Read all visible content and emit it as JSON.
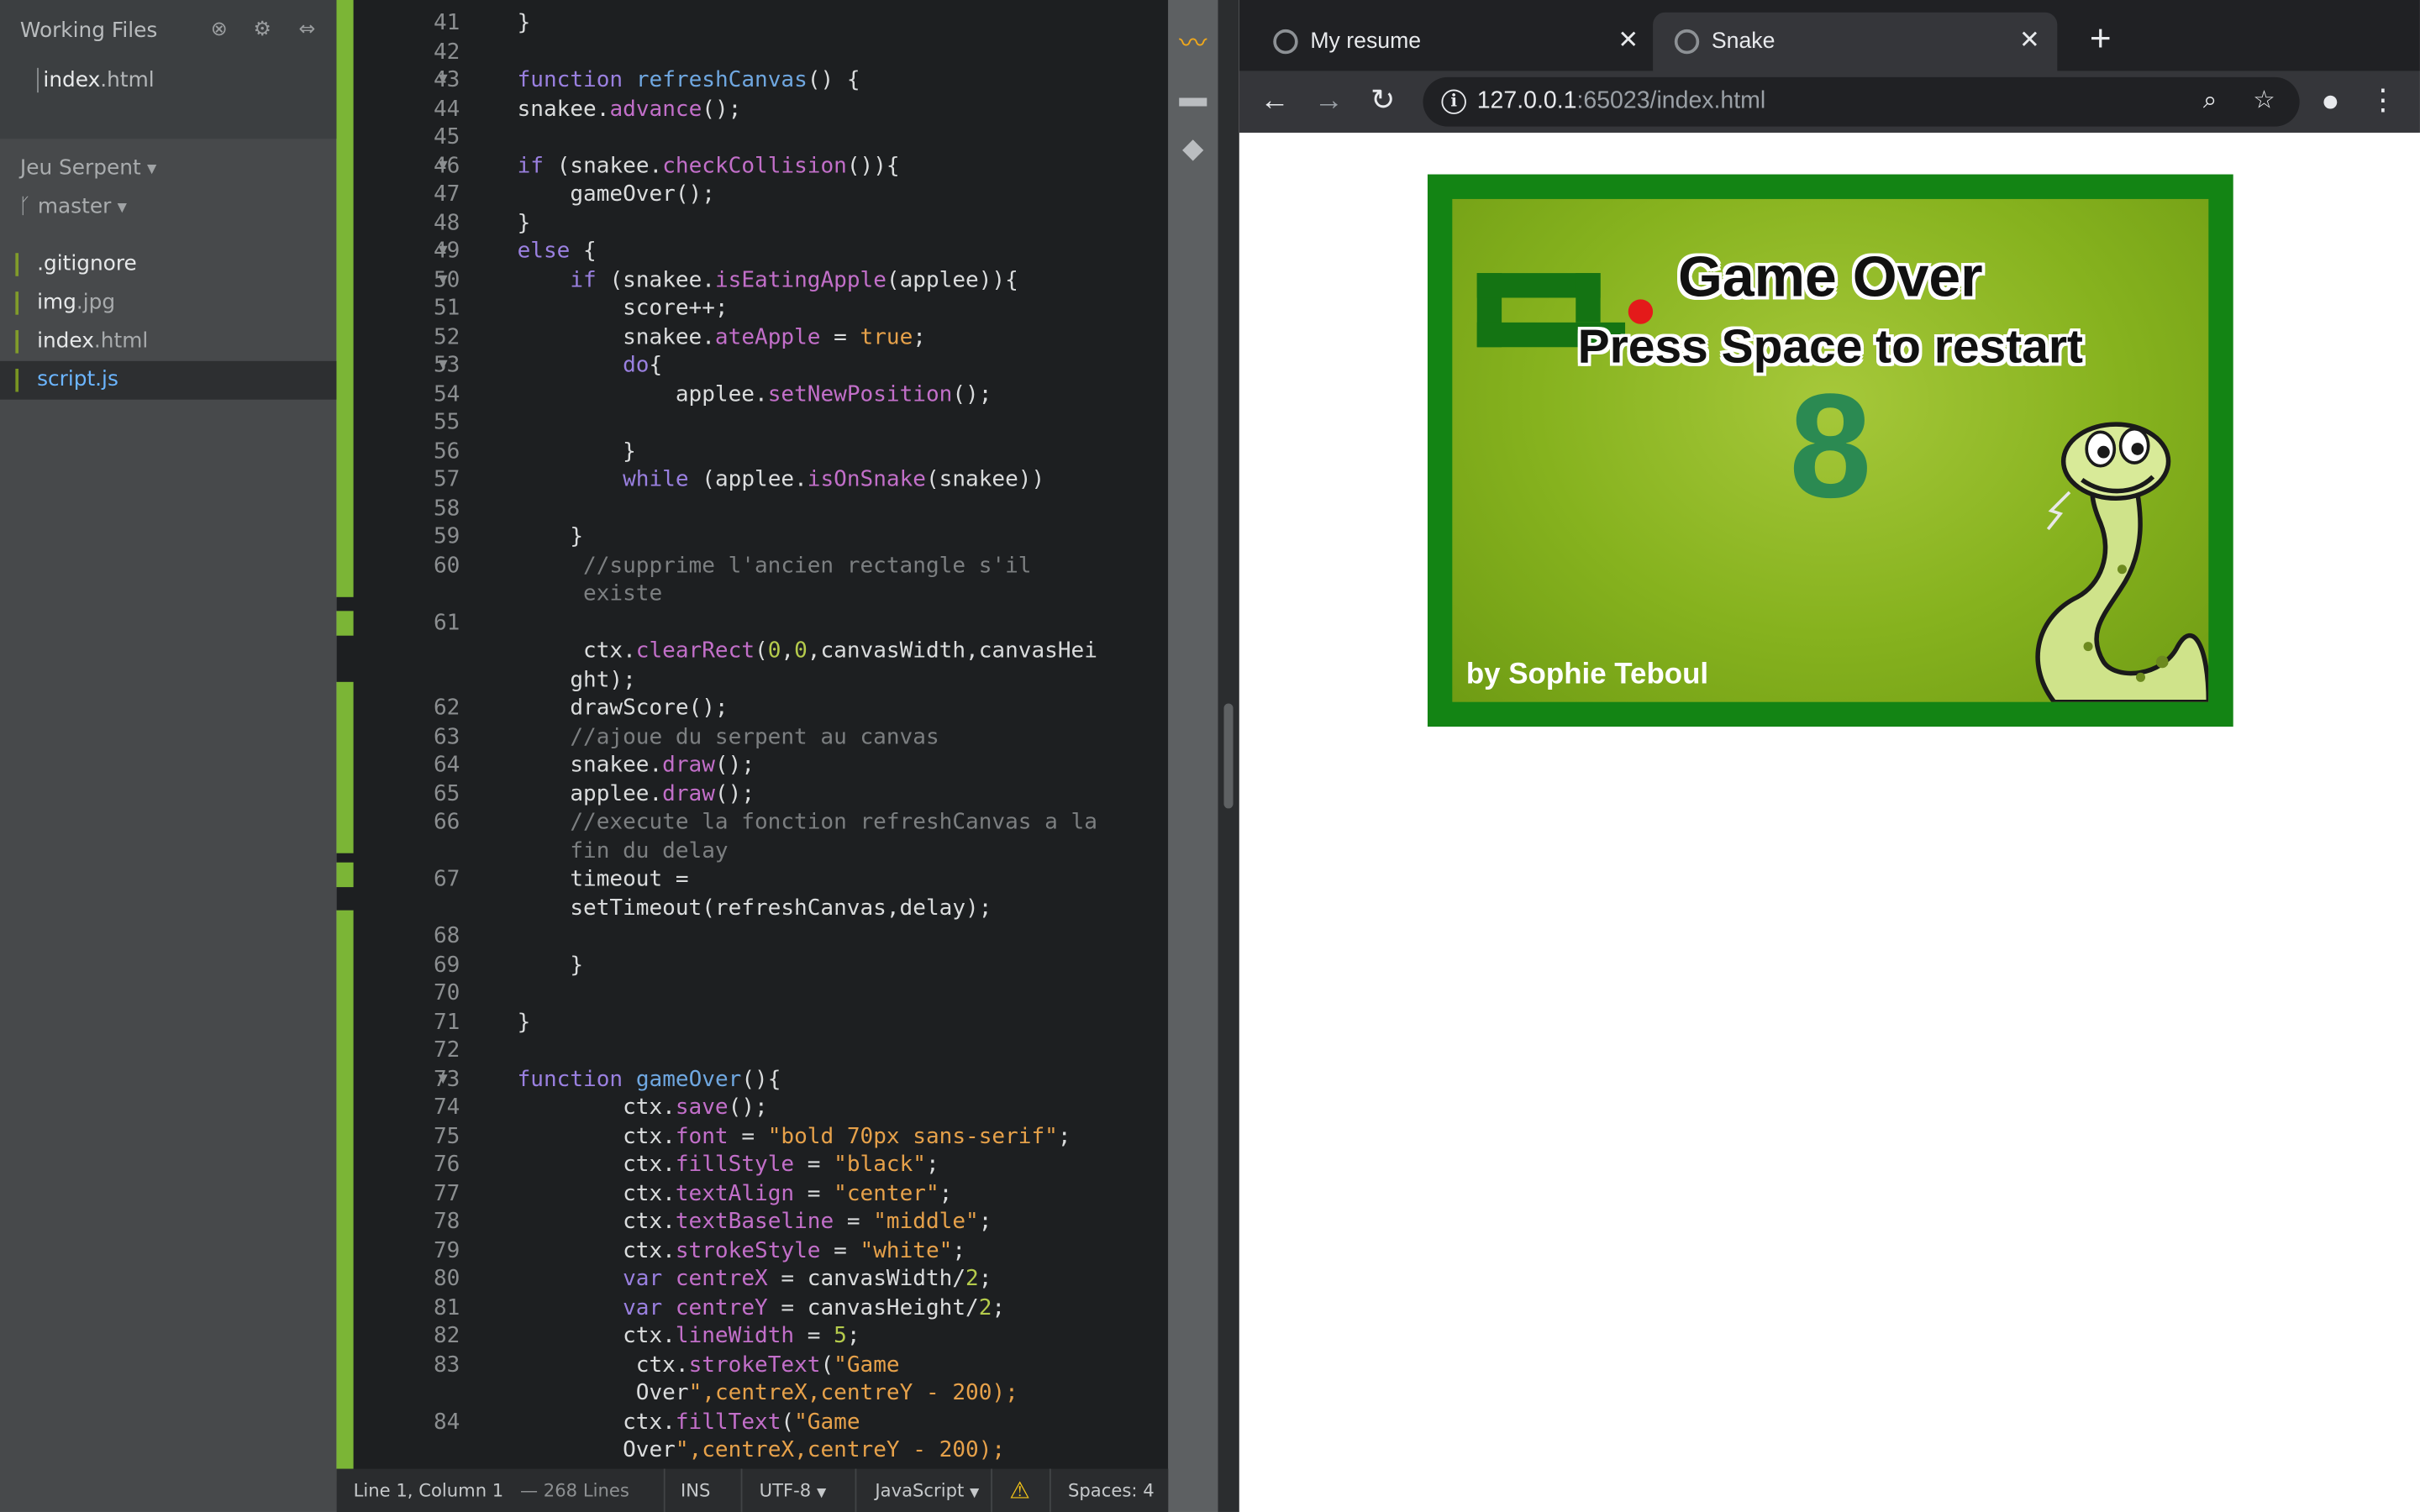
{
  "sidebar": {
    "working_files_title": "Working Files",
    "working_files": [
      {
        "name": "index",
        "ext": ".html"
      }
    ],
    "project_name": "Jeu Serpent",
    "branch": "master",
    "tree": [
      {
        "name": ".gitignore",
        "ext": ""
      },
      {
        "name": "img",
        "ext": ".jpg"
      },
      {
        "name": "index",
        "ext": ".html"
      },
      {
        "name": "script.js",
        "ext": ""
      }
    ],
    "selected_file": "script.js"
  },
  "editor": {
    "lines": [
      {
        "n": "41",
        "text": "    }"
      },
      {
        "n": "42",
        "text": ""
      },
      {
        "n": "43",
        "text": "    function refreshCanvas() {",
        "fold": true
      },
      {
        "n": "44",
        "text": "    snakee.advance();"
      },
      {
        "n": "45",
        "text": ""
      },
      {
        "n": "46",
        "text": "    if (snakee.checkCollision()){",
        "fold": true
      },
      {
        "n": "47",
        "text": "        gameOver();"
      },
      {
        "n": "48",
        "text": "    }"
      },
      {
        "n": "49",
        "text": "    else {",
        "fold": true
      },
      {
        "n": "50",
        "text": "        if (snakee.isEatingApple(applee)){",
        "fold": true
      },
      {
        "n": "51",
        "text": "            score++;"
      },
      {
        "n": "52",
        "text": "            snakee.ateApple = true;"
      },
      {
        "n": "53",
        "text": "            do{",
        "fold": true
      },
      {
        "n": "54",
        "text": "                applee.setNewPosition();"
      },
      {
        "n": "55",
        "text": ""
      },
      {
        "n": "56",
        "text": "            }"
      },
      {
        "n": "57",
        "text": "            while (applee.isOnSnake(snakee))"
      },
      {
        "n": "58",
        "text": ""
      },
      {
        "n": "59",
        "text": "        }"
      },
      {
        "n": "60",
        "text": "         //supprime l'ancien rectangle s'il"
      },
      {
        "n": "",
        "text": "         existe"
      },
      {
        "n": "61",
        "text": ""
      },
      {
        "n": "",
        "text": "         ctx.clearRect(0,0,canvasWidth,canvasHei"
      },
      {
        "n": "",
        "text": "        ght);"
      },
      {
        "n": "62",
        "text": "        drawScore();"
      },
      {
        "n": "63",
        "text": "        //ajoue du serpent au canvas"
      },
      {
        "n": "64",
        "text": "        snakee.draw();"
      },
      {
        "n": "65",
        "text": "        applee.draw();"
      },
      {
        "n": "66",
        "text": "        //execute la fonction refreshCanvas a la"
      },
      {
        "n": "",
        "text": "        fin du delay"
      },
      {
        "n": "67",
        "text": "        timeout ="
      },
      {
        "n": "",
        "text": "        setTimeout(refreshCanvas,delay);"
      },
      {
        "n": "68",
        "text": ""
      },
      {
        "n": "69",
        "text": "        }"
      },
      {
        "n": "70",
        "text": ""
      },
      {
        "n": "71",
        "text": "    }"
      },
      {
        "n": "72",
        "text": ""
      },
      {
        "n": "73",
        "text": "    function gameOver(){",
        "fold": true
      },
      {
        "n": "74",
        "text": "            ctx.save();"
      },
      {
        "n": "75",
        "text": "            ctx.font = \"bold 70px sans-serif\";"
      },
      {
        "n": "76",
        "text": "            ctx.fillStyle = \"black\";"
      },
      {
        "n": "77",
        "text": "            ctx.textAlign = \"center\";"
      },
      {
        "n": "78",
        "text": "            ctx.textBaseline = \"middle\";"
      },
      {
        "n": "79",
        "text": "            ctx.strokeStyle = \"white\";"
      },
      {
        "n": "80",
        "text": "            var centreX = canvasWidth/2;"
      },
      {
        "n": "81",
        "text": "            var centreY = canvasHeight/2;"
      },
      {
        "n": "82",
        "text": "            ctx.lineWidth = 5;"
      },
      {
        "n": "83",
        "text": "             ctx.strokeText(\"Game"
      },
      {
        "n": "",
        "text": "             Over\",centreX,centreY - 200);"
      },
      {
        "n": "84",
        "text": "            ctx.fillText(\"Game"
      },
      {
        "n": "",
        "text": "            Over\",centreX,centreY - 200);"
      }
    ]
  },
  "statusbar": {
    "cursor": "Line 1, Column 1",
    "lines_count": "— 268 Lines",
    "mode": "INS",
    "encoding": "UTF-8",
    "language": "JavaScript",
    "spaces": "Spaces: 4"
  },
  "browser": {
    "tabs": [
      {
        "title": "My resume",
        "active": false
      },
      {
        "title": "Snake",
        "active": true
      }
    ],
    "url_host": "127.0.0.1",
    "url_rest": ":65023/index.html"
  },
  "game": {
    "title": "Game Over",
    "subtitle": "Press Space to restart",
    "score": "8",
    "credit": "by Sophie Teboul"
  },
  "colors": {
    "game_border": "#138414",
    "snake": "#147413",
    "apple": "#e41a1a",
    "score": "#2b8a52"
  }
}
